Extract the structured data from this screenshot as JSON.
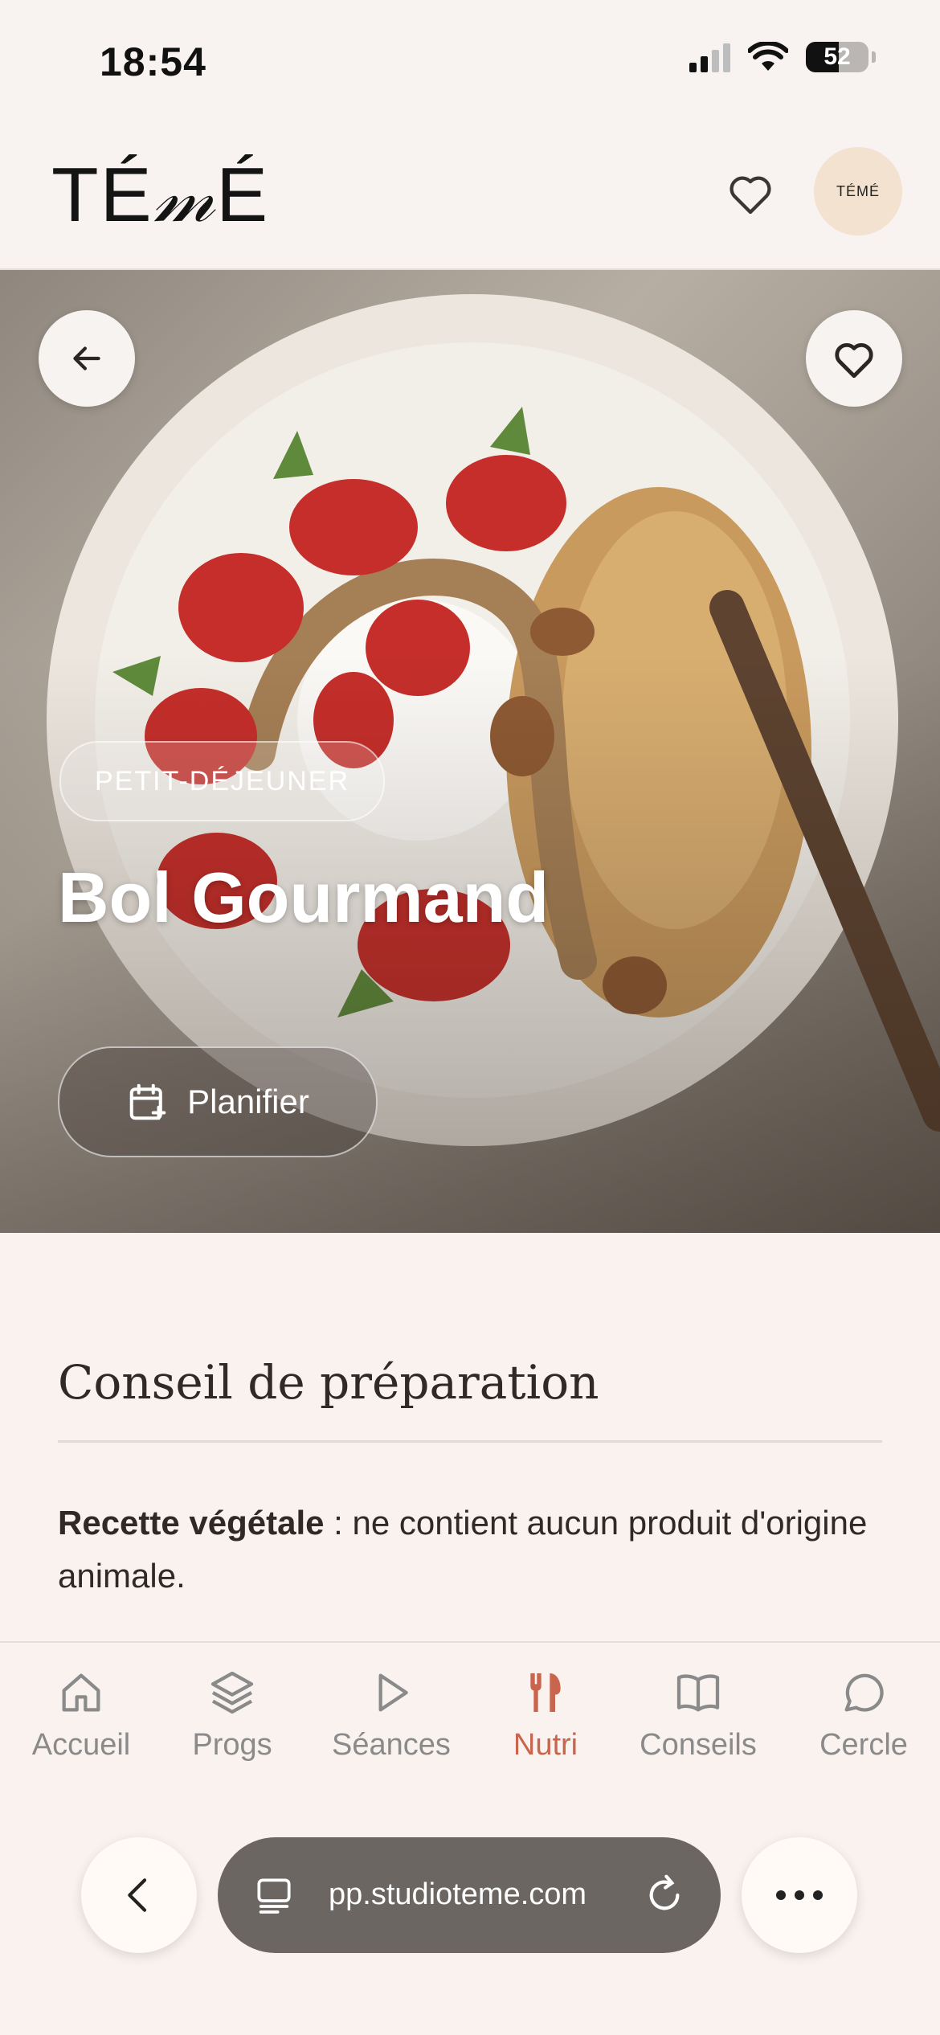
{
  "status": {
    "time": "18:54",
    "battery": "52",
    "battery_level": 0.52
  },
  "header": {
    "logo_left": "TÉ",
    "logo_mid": "𝓂",
    "logo_right": "É",
    "avatar_text": "TÉMÉ"
  },
  "hero": {
    "category": "PETIT-DÉJEUNER",
    "title": "Bol Gourmand",
    "plan_label": "Planifier"
  },
  "content": {
    "section_title": "Conseil de préparation",
    "tip_bold": "Recette végétale",
    "tip_rest": " : ne contient aucun produit d'origine animale."
  },
  "nav": {
    "items": [
      {
        "label": "Accueil",
        "icon": "home-icon"
      },
      {
        "label": "Progs",
        "icon": "layers-icon"
      },
      {
        "label": "Séances",
        "icon": "play-icon"
      },
      {
        "label": "Nutri",
        "icon": "utensils-icon",
        "active": true
      },
      {
        "label": "Conseils",
        "icon": "book-icon"
      },
      {
        "label": "Cercle",
        "icon": "chat-bubble-icon"
      }
    ],
    "active_color": "#c9644d",
    "inactive_color": "#8a8a8a"
  },
  "browser": {
    "url": "pp.studioteme.com"
  }
}
